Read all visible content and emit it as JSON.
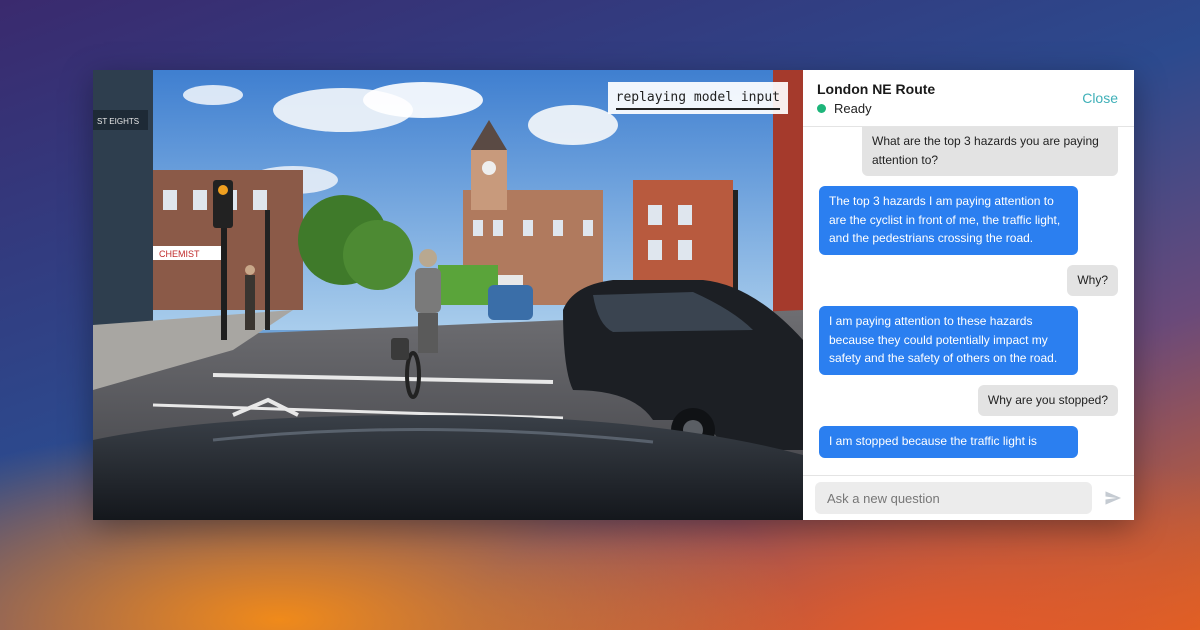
{
  "video": {
    "overlay_label": "replaying model input",
    "shop_sign": "CHEMIST",
    "pub_sign": "ST EIGHTS"
  },
  "chat": {
    "title": "London NE Route",
    "status": "Ready",
    "close_label": "Close",
    "messages": [
      {
        "role": "user",
        "text": "What are the top 3 hazards you are paying attention to?"
      },
      {
        "role": "bot",
        "text": "The top 3 hazards I am paying attention to are the cyclist in front of me, the traffic light, and the pedestrians crossing the road."
      },
      {
        "role": "user",
        "text": "Why?"
      },
      {
        "role": "bot",
        "text": "I am paying attention to these hazards because they could potentially impact my safety and the safety of others on the road."
      },
      {
        "role": "user",
        "text": "Why are you stopped?"
      },
      {
        "role": "bot",
        "text": "I am stopped because the traffic light is"
      }
    ],
    "input_placeholder": "Ask a new question"
  },
  "colors": {
    "accent_blue": "#2b7ff0",
    "status_green": "#1db57a",
    "close_teal": "#3fb0b8"
  }
}
